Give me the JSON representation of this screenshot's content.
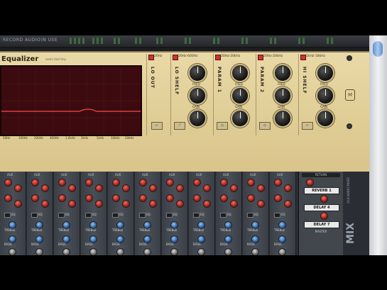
{
  "topbar": {
    "left_text": "RECORD AUDIO",
    "mid_text": "IN USE"
  },
  "eq": {
    "title": "Equalizer",
    "info": "some text tiny",
    "graph_freqs": [
      "50Hz",
      "100Hz",
      "200Hz",
      "400Hz",
      "1.0kHz",
      "2kHz",
      "5kHz",
      "10kHz",
      "20kHz"
    ],
    "bands": [
      {
        "label": "LO OUT",
        "range": "20Hz"
      },
      {
        "label": "LO SHELF",
        "range": "20Hz-600Hz",
        "knob_labels": [
          "FREQ",
          "GAIN",
          "Q"
        ]
      },
      {
        "label": "PARAM 1",
        "range": "20Hz-20kHz",
        "knob_labels": [
          "FREQ",
          "GAIN",
          "Q"
        ]
      },
      {
        "label": "PARAM 2",
        "range": "20Hz-20kHz",
        "knob_labels": [
          "FREQ",
          "GAIN",
          "Q"
        ]
      },
      {
        "label": "HI SHELF",
        "range": "1kHz-18kHz",
        "knob_labels": [
          "FREQ",
          "GAIN",
          "Q"
        ]
      }
    ]
  },
  "mixer": {
    "strip_aux": "AUX",
    "strip_eq": "EQ",
    "strip_treble": "TREBLE",
    "strip_bass": "BASS",
    "returns_header": "RETURN",
    "returns": [
      "REVERB 1",
      "DELAY 4",
      "DELAY 7"
    ],
    "master_label": "MASTER",
    "mix_label": "MIX",
    "mix_sub": "14:8 AUDIO MIXER"
  },
  "colors": {
    "eq_panel": "#e3d29d",
    "graph_bg": "#3b0b10",
    "mixer_bg": "#2a2d33",
    "accent_red": "#cc3322"
  }
}
